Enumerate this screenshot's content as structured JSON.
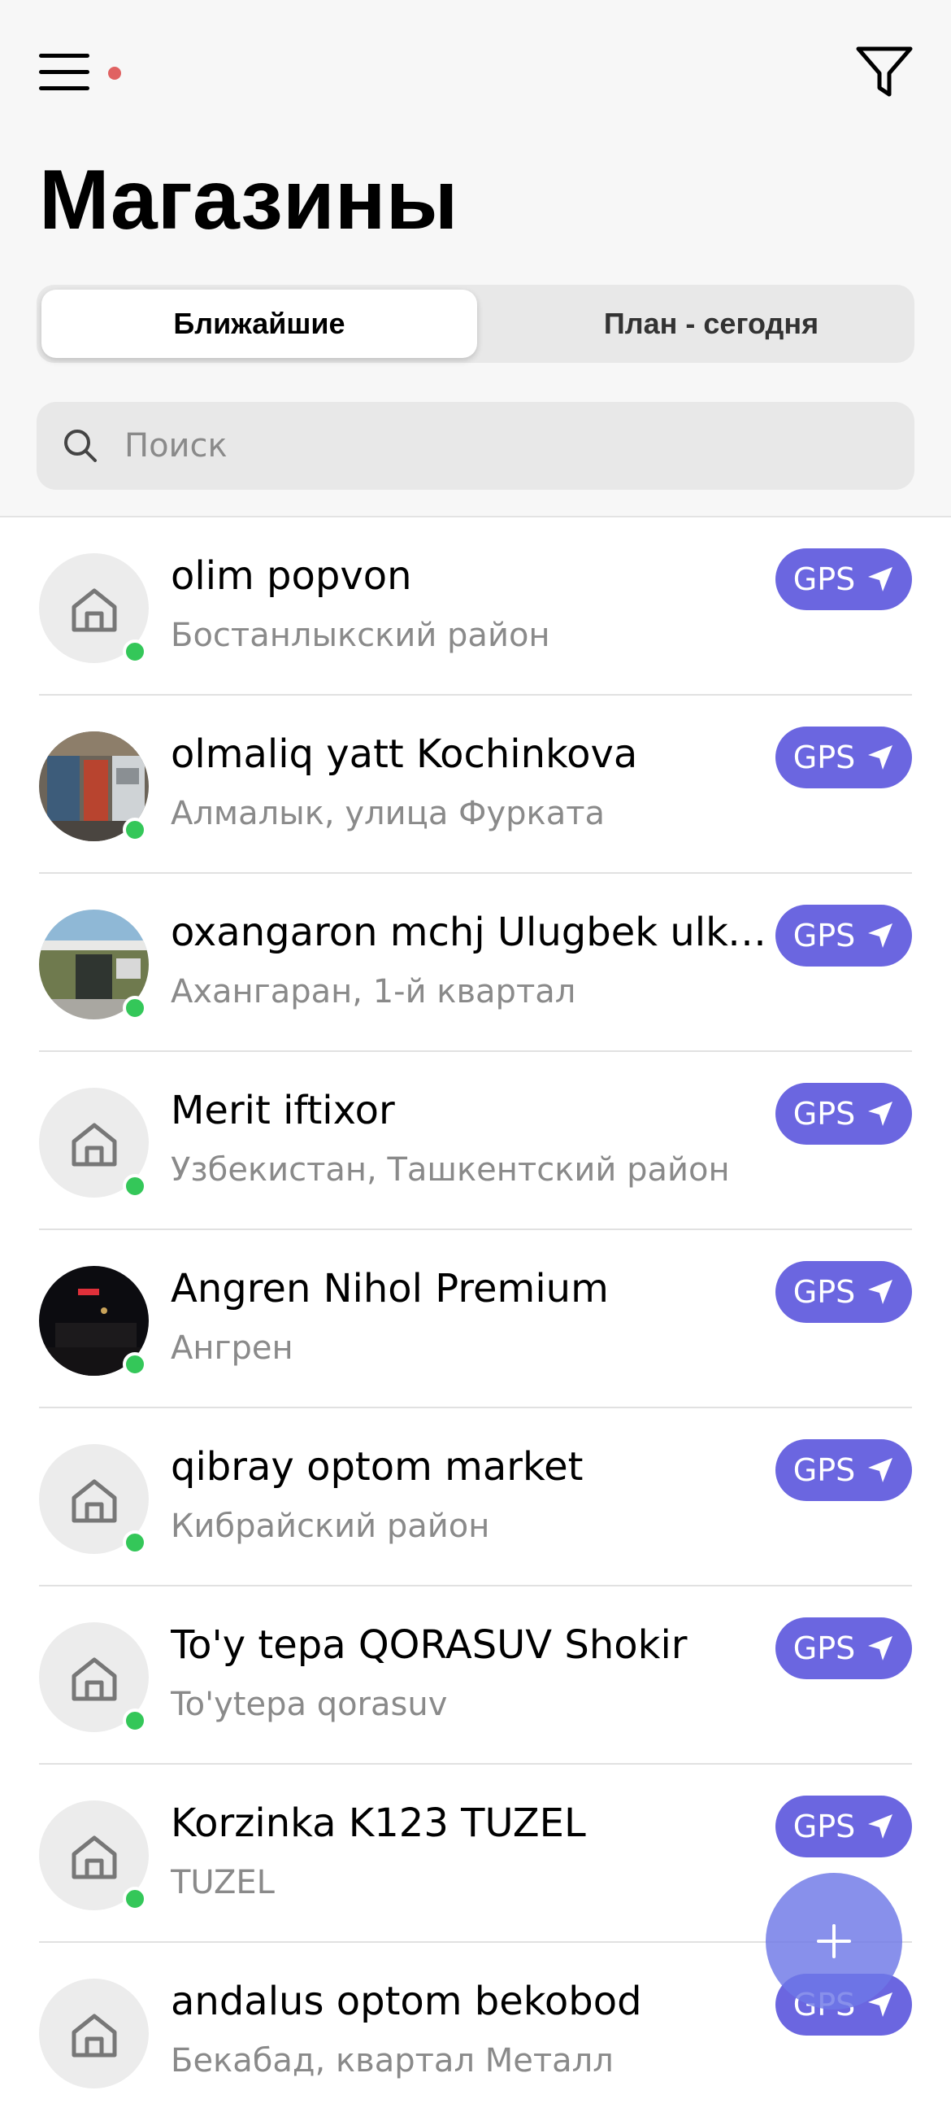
{
  "header": {
    "title": "Магазины",
    "menu_icon": "hamburger-menu-icon",
    "filter_icon": "filter-funnel-icon",
    "notification_dot_color": "#e06262"
  },
  "tabs": [
    {
      "label": "Ближайшие",
      "active": true
    },
    {
      "label": "План - сегодня",
      "active": false
    }
  ],
  "search": {
    "placeholder": "Поиск",
    "value": "",
    "icon": "search-icon"
  },
  "stores": [
    {
      "name": "olim popvon",
      "address": "Бостанлыкский район",
      "avatar": "house-icon",
      "online": true,
      "gps_label": "GPS"
    },
    {
      "name": "olmaliq yatt Kochinkova",
      "address": "Алмалык, улица Фурката",
      "avatar": "storefront-photo",
      "online": true,
      "gps_label": "GPS"
    },
    {
      "name": "oxangaron mchj Ulugbek ulka...",
      "address": "Ахангаран, 1-й квартал",
      "avatar": "storefront-photo",
      "online": true,
      "gps_label": "GPS"
    },
    {
      "name": "Merit iftixor",
      "address": "Узбекистан, Ташкентский район",
      "avatar": "house-icon",
      "online": true,
      "gps_label": "GPS"
    },
    {
      "name": "Angren Nihol Premium",
      "address": "Ангрен",
      "avatar": "night-storefront-photo",
      "online": true,
      "gps_label": "GPS"
    },
    {
      "name": "qibray optom market",
      "address": "Кибрайский район",
      "avatar": "house-icon",
      "online": true,
      "gps_label": "GPS"
    },
    {
      "name": "To'y tepa QORASUV Shokir",
      "address": "To'ytepa qorasuv",
      "avatar": "house-icon",
      "online": true,
      "gps_label": "GPS"
    },
    {
      "name": "Korzinka K123 TUZEL",
      "address": "TUZEL",
      "avatar": "house-icon",
      "online": true,
      "gps_label": "GPS"
    },
    {
      "name": "andalus optom bekobod",
      "address": "Бекабад, квартал Металл",
      "avatar": "house-icon",
      "online": false,
      "gps_label": "GPS"
    }
  ],
  "fab": {
    "icon": "plus-icon"
  },
  "colors": {
    "accent": "#6b66e0",
    "online": "#34c759",
    "secondary_text": "#8a8a8a"
  }
}
